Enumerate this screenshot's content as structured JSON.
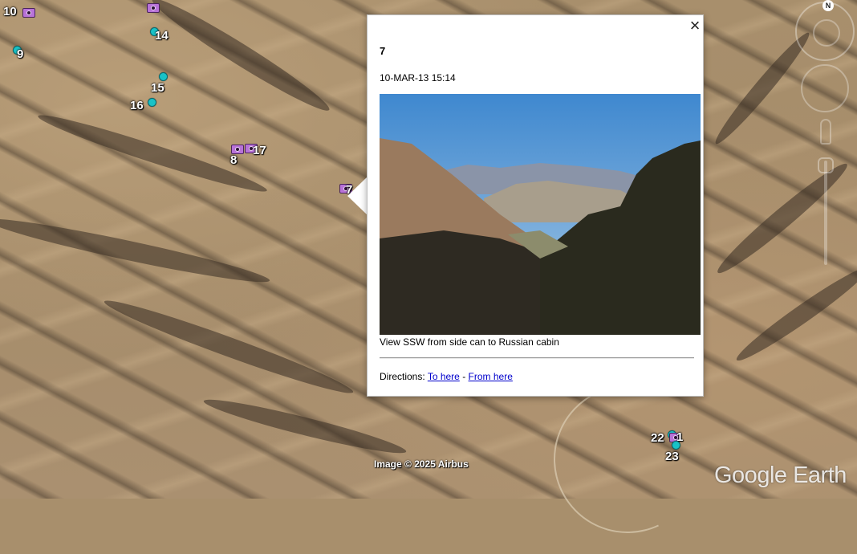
{
  "map": {
    "markers": [
      {
        "id": "m10",
        "label": "10",
        "kind": "camera"
      },
      {
        "id": "m9",
        "label": "9",
        "kind": "pin"
      },
      {
        "id": "m14",
        "label": "14",
        "kind": "pin"
      },
      {
        "id": "m15",
        "label": "15",
        "kind": "pin"
      },
      {
        "id": "m16",
        "label": "16",
        "kind": "pin"
      },
      {
        "id": "m8",
        "label": "8",
        "kind": "camera"
      },
      {
        "id": "m17",
        "label": "17",
        "kind": "camera"
      },
      {
        "id": "m7",
        "label": "7",
        "kind": "camera"
      },
      {
        "id": "m22",
        "label": "22",
        "kind": "pin"
      },
      {
        "id": "m1",
        "label": "1",
        "kind": "camera"
      },
      {
        "id": "m23",
        "label": "23",
        "kind": "pin"
      }
    ],
    "imagery_credit": "Image © 2025 Airbus",
    "brand": "Google Earth",
    "compass_north": "N"
  },
  "balloon": {
    "title": "7",
    "date": "10-MAR-13 15:14",
    "photo_alt": "Desert canyon view",
    "caption": "View SSW from side can to Russian cabin",
    "directions_label": "Directions:",
    "to_here": "To here",
    "separator": "-",
    "from_here": "From here",
    "close_icon": "×"
  },
  "colors": {
    "pin": "#19c2c7",
    "camera": "#b872d8",
    "link": "#0000cc"
  }
}
